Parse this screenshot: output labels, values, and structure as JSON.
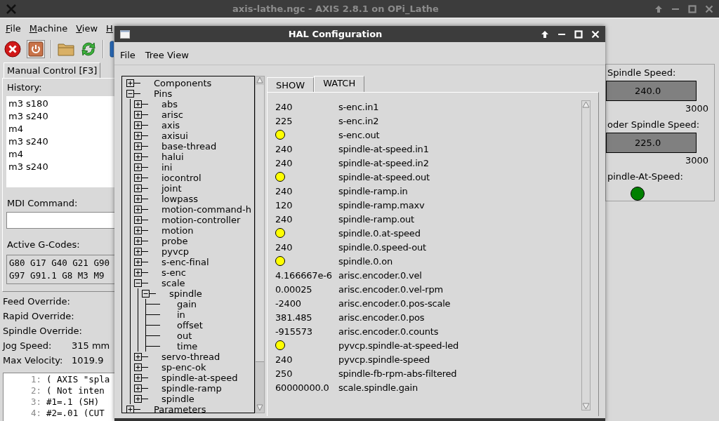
{
  "main_window": {
    "title": "axis-lathe.ngc - AXIS 2.8.1 on OPi_Lathe"
  },
  "main_menu": [
    "File",
    "Machine",
    "View",
    "H"
  ],
  "main_tabs": [
    {
      "label": "Manual Control [F3]",
      "selected": true
    }
  ],
  "history": {
    "label": "History:",
    "items": [
      "m3 s180",
      "m3 s240",
      "m4",
      "m3 s240",
      "m4",
      "m3 s240"
    ]
  },
  "mdi": {
    "label": "MDI Command:"
  },
  "active_gcodes": {
    "label": "Active G-Codes:",
    "lines": [
      "G80 G17 G40 G21 G90",
      "G97 G91.1 G8 M3 M9"
    ]
  },
  "status": [
    {
      "label": "Feed Override:"
    },
    {
      "label": "Rapid Override:"
    },
    {
      "label": "Spindle Override:"
    },
    {
      "label": "Jog Speed:",
      "value": "315 mm"
    },
    {
      "label": "Max Velocity:",
      "value": "1019.9"
    }
  ],
  "gcode_listing": [
    {
      "number": "1:",
      "text": "( AXIS \"spla"
    },
    {
      "number": "2:",
      "text": "( Not inten"
    },
    {
      "number": "3:",
      "text": "#1=.1 (SH)"
    },
    {
      "number": "4:",
      "text": "#2=.01 (CUT"
    }
  ],
  "pyvcp": [
    {
      "kind": "bar",
      "label": "Spindle Speed:",
      "value": "240.0",
      "max": "3000"
    },
    {
      "kind": "bar",
      "label": "oder Spindle Speed:",
      "value": "225.0",
      "max": "3000"
    },
    {
      "kind": "led",
      "label": "pindle-At-Speed:",
      "on": true
    }
  ],
  "hal_window": {
    "title": "HAL Configuration",
    "menu": [
      "File",
      "Tree View"
    ],
    "tabs": [
      {
        "label": "SHOW",
        "selected": false
      },
      {
        "label": "WATCH",
        "selected": true
      }
    ]
  },
  "tree": [
    {
      "label": "Components",
      "expanded": false
    },
    {
      "label": "Pins",
      "expanded": true,
      "children": [
        {
          "label": "abs",
          "expanded": false
        },
        {
          "label": "arisc",
          "expanded": false
        },
        {
          "label": "axis",
          "expanded": false
        },
        {
          "label": "axisui",
          "expanded": false
        },
        {
          "label": "base-thread",
          "expanded": false
        },
        {
          "label": "halui",
          "expanded": false
        },
        {
          "label": "ini",
          "expanded": false
        },
        {
          "label": "iocontrol",
          "expanded": false
        },
        {
          "label": "joint",
          "expanded": false
        },
        {
          "label": "lowpass",
          "expanded": false
        },
        {
          "label": "motion-command-h",
          "expanded": false
        },
        {
          "label": "motion-controller",
          "expanded": false
        },
        {
          "label": "motion",
          "expanded": false
        },
        {
          "label": "probe",
          "expanded": false
        },
        {
          "label": "pyvcp",
          "expanded": false
        },
        {
          "label": "s-enc-final",
          "expanded": false
        },
        {
          "label": "s-enc",
          "expanded": false
        },
        {
          "label": "scale",
          "expanded": true,
          "children": [
            {
              "label": "spindle",
              "expanded": true,
              "children": [
                {
                  "label": "gain"
                },
                {
                  "label": "in"
                },
                {
                  "label": "offset"
                },
                {
                  "label": "out"
                },
                {
                  "label": "time"
                }
              ]
            }
          ]
        },
        {
          "label": "servo-thread",
          "expanded": false
        },
        {
          "label": "sp-enc-ok",
          "expanded": false
        },
        {
          "label": "spindle-at-speed",
          "expanded": false
        },
        {
          "label": "spindle-ramp",
          "expanded": false
        },
        {
          "label": "spindle",
          "expanded": false
        }
      ]
    },
    {
      "label": "Parameters",
      "expanded": false
    }
  ],
  "watch": [
    {
      "kind": "value",
      "value": "240",
      "name": "s-enc.in1"
    },
    {
      "kind": "value",
      "value": "225",
      "name": "s-enc.in2"
    },
    {
      "kind": "bit",
      "on": true,
      "name": "s-enc.out"
    },
    {
      "kind": "value",
      "value": "240",
      "name": "spindle-at-speed.in1"
    },
    {
      "kind": "value",
      "value": "240",
      "name": "spindle-at-speed.in2"
    },
    {
      "kind": "bit",
      "on": true,
      "name": "spindle-at-speed.out"
    },
    {
      "kind": "value",
      "value": "240",
      "name": "spindle-ramp.in"
    },
    {
      "kind": "value",
      "value": "120",
      "name": "spindle-ramp.maxv"
    },
    {
      "kind": "value",
      "value": "240",
      "name": "spindle-ramp.out"
    },
    {
      "kind": "bit",
      "on": true,
      "name": "spindle.0.at-speed"
    },
    {
      "kind": "value",
      "value": "240",
      "name": "spindle.0.speed-out"
    },
    {
      "kind": "bit",
      "on": true,
      "name": "spindle.0.on"
    },
    {
      "kind": "value",
      "value": "4.166667e-6",
      "name": "arisc.encoder.0.vel"
    },
    {
      "kind": "value",
      "value": "0.00025",
      "name": "arisc.encoder.0.vel-rpm"
    },
    {
      "kind": "value",
      "value": "-2400",
      "name": "arisc.encoder.0.pos-scale"
    },
    {
      "kind": "value",
      "value": "381.485",
      "name": "arisc.encoder.0.pos"
    },
    {
      "kind": "value",
      "value": "-915573",
      "name": "arisc.encoder.0.counts"
    },
    {
      "kind": "bit",
      "on": true,
      "name": "pyvcp.spindle-at-speed-led"
    },
    {
      "kind": "value",
      "value": "240",
      "name": "pyvcp.spindle-speed"
    },
    {
      "kind": "value",
      "value": "250",
      "name": "spindle-fb-rpm-abs-filtered"
    },
    {
      "kind": "value",
      "value": "60000000.0",
      "name": "scale.spindle.gain"
    }
  ]
}
